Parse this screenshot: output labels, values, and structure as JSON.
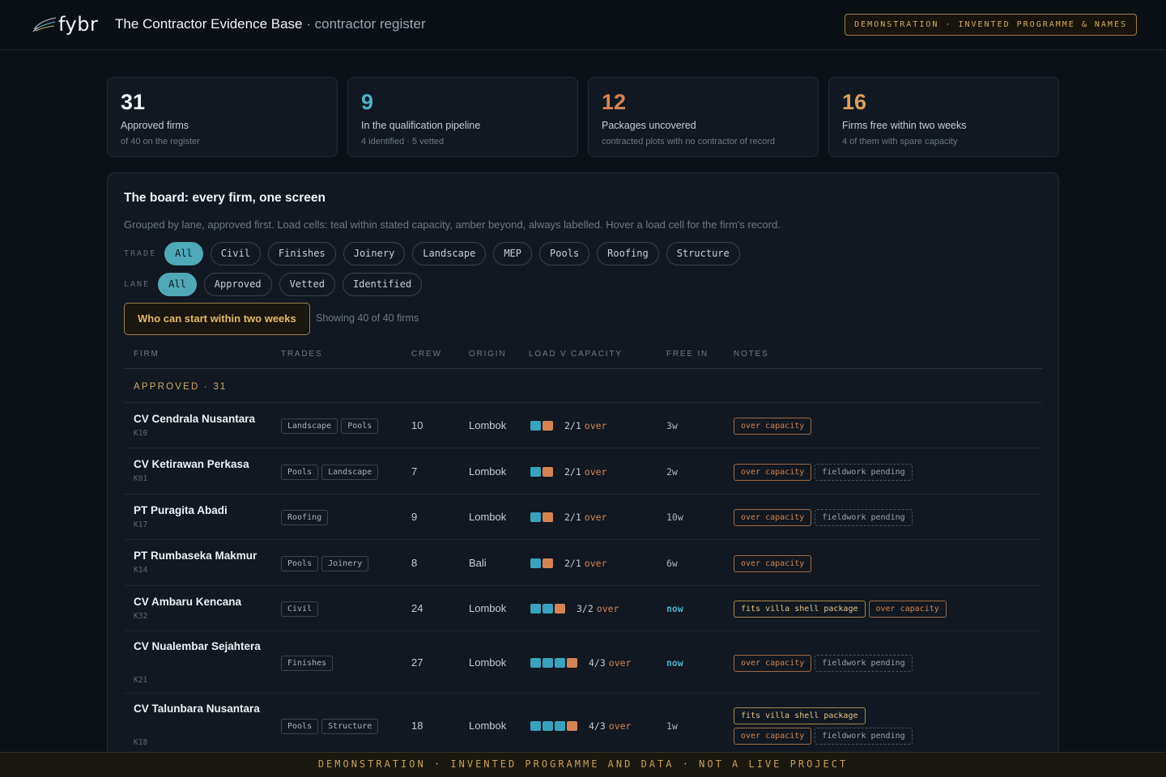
{
  "header": {
    "logo_text": "fybr",
    "title": "The Contractor Evidence Base",
    "subtitle": "· contractor register",
    "demo_badge": "DEMONSTRATION · INVENTED PROGRAMME & NAMES"
  },
  "stats": [
    {
      "value": "31",
      "label": "Approved firms",
      "sub": "of 40 on the register",
      "color": "#f2f4f6"
    },
    {
      "value": "9",
      "label": "In the qualification pipeline",
      "sub": "4 identified · 5 vetted",
      "color": "#4fb0c8"
    },
    {
      "value": "12",
      "label": "Packages uncovered",
      "sub": "contracted plots with no contractor of record",
      "color": "#d48454"
    },
    {
      "value": "16",
      "label": "Firms free within two weeks",
      "sub": "4 of them with spare capacity",
      "color": "#d9a05c"
    }
  ],
  "board": {
    "title": "The board: every firm, one screen",
    "description": "Grouped by lane, approved first. Load cells: teal within stated capacity, amber beyond, always labelled. Hover a load cell for the firm's record.",
    "trade_label": "TRADE",
    "trades": [
      "All",
      "Civil",
      "Finishes",
      "Joinery",
      "Landscape",
      "MEP",
      "Pools",
      "Roofing",
      "Structure"
    ],
    "lane_label": "LANE",
    "lanes": [
      "All",
      "Approved",
      "Vetted",
      "Identified"
    ],
    "start_button": "Who can start within two weeks",
    "showing": "Showing 40 of 40 firms"
  },
  "table": {
    "headers": {
      "firm": "FIRM",
      "trades": "TRADES",
      "crew": "CREW",
      "origin": "ORIGIN",
      "load": "LOAD V CAPACITY",
      "free": "FREE IN",
      "notes": "NOTES"
    },
    "group_label": "APPROVED · 31",
    "rows": [
      {
        "name": "CV Cendrala Nusantara",
        "code": "K10",
        "trades": [
          "Landscape",
          "Pools"
        ],
        "crew": "10",
        "origin": "Lombok",
        "load": "2/1",
        "over": "over",
        "cells": [
          "teal",
          "amber"
        ],
        "free": "3w",
        "notes": [
          {
            "t": "over capacity",
            "k": "over"
          }
        ]
      },
      {
        "name": "CV Ketirawan Perkasa",
        "code": "K01",
        "trades": [
          "Pools",
          "Landscape"
        ],
        "crew": "7",
        "origin": "Lombok",
        "load": "2/1",
        "over": "over",
        "cells": [
          "teal",
          "amber"
        ],
        "free": "2w",
        "notes": [
          {
            "t": "over capacity",
            "k": "over"
          },
          {
            "t": "fieldwork pending",
            "k": "field"
          }
        ]
      },
      {
        "name": "PT Puragita Abadi",
        "code": "K17",
        "trades": [
          "Roofing"
        ],
        "crew": "9",
        "origin": "Lombok",
        "load": "2/1",
        "over": "over",
        "cells": [
          "teal",
          "amber"
        ],
        "free": "10w",
        "notes": [
          {
            "t": "over capacity",
            "k": "over"
          },
          {
            "t": "fieldwork pending",
            "k": "field"
          }
        ]
      },
      {
        "name": "PT Rumbaseka Makmur",
        "code": "K14",
        "trades": [
          "Pools",
          "Joinery"
        ],
        "crew": "8",
        "origin": "Bali",
        "load": "2/1",
        "over": "over",
        "cells": [
          "teal",
          "amber"
        ],
        "free": "6w",
        "notes": [
          {
            "t": "over capacity",
            "k": "over"
          }
        ]
      },
      {
        "name": "CV Ambaru Kencana",
        "code": "K32",
        "trades": [
          "Civil"
        ],
        "crew": "24",
        "origin": "Lombok",
        "load": "3/2",
        "over": "over",
        "cells": [
          "teal",
          "teal",
          "amber"
        ],
        "free": "now",
        "notes": [
          {
            "t": "fits villa shell package",
            "k": "fits"
          },
          {
            "t": "over capacity",
            "k": "over"
          }
        ]
      },
      {
        "name": "CV Nualembar Sejahtera",
        "code": "K21",
        "trades": [
          "Finishes"
        ],
        "crew": "27",
        "origin": "Lombok",
        "load": "4/3",
        "over": "over",
        "cells": [
          "teal",
          "teal",
          "teal",
          "amber"
        ],
        "free": "now",
        "notes": [
          {
            "t": "over capacity",
            "k": "over"
          },
          {
            "t": "fieldwork pending",
            "k": "field"
          }
        ]
      },
      {
        "name": "CV Talunbara Nusantara",
        "code": "K18",
        "trades": [
          "Pools",
          "Structure"
        ],
        "crew": "18",
        "origin": "Lombok",
        "load": "4/3",
        "over": "over",
        "cells": [
          "teal",
          "teal",
          "teal",
          "amber"
        ],
        "free": "1w",
        "notes": [
          {
            "t": "fits villa shell package",
            "k": "fits"
          },
          {
            "t": "over capacity",
            "k": "over"
          },
          {
            "t": "fieldwork pending",
            "k": "field"
          }
        ]
      }
    ]
  },
  "footer": "DEMONSTRATION · INVENTED PROGRAMME AND DATA · NOT A LIVE PROJECT"
}
